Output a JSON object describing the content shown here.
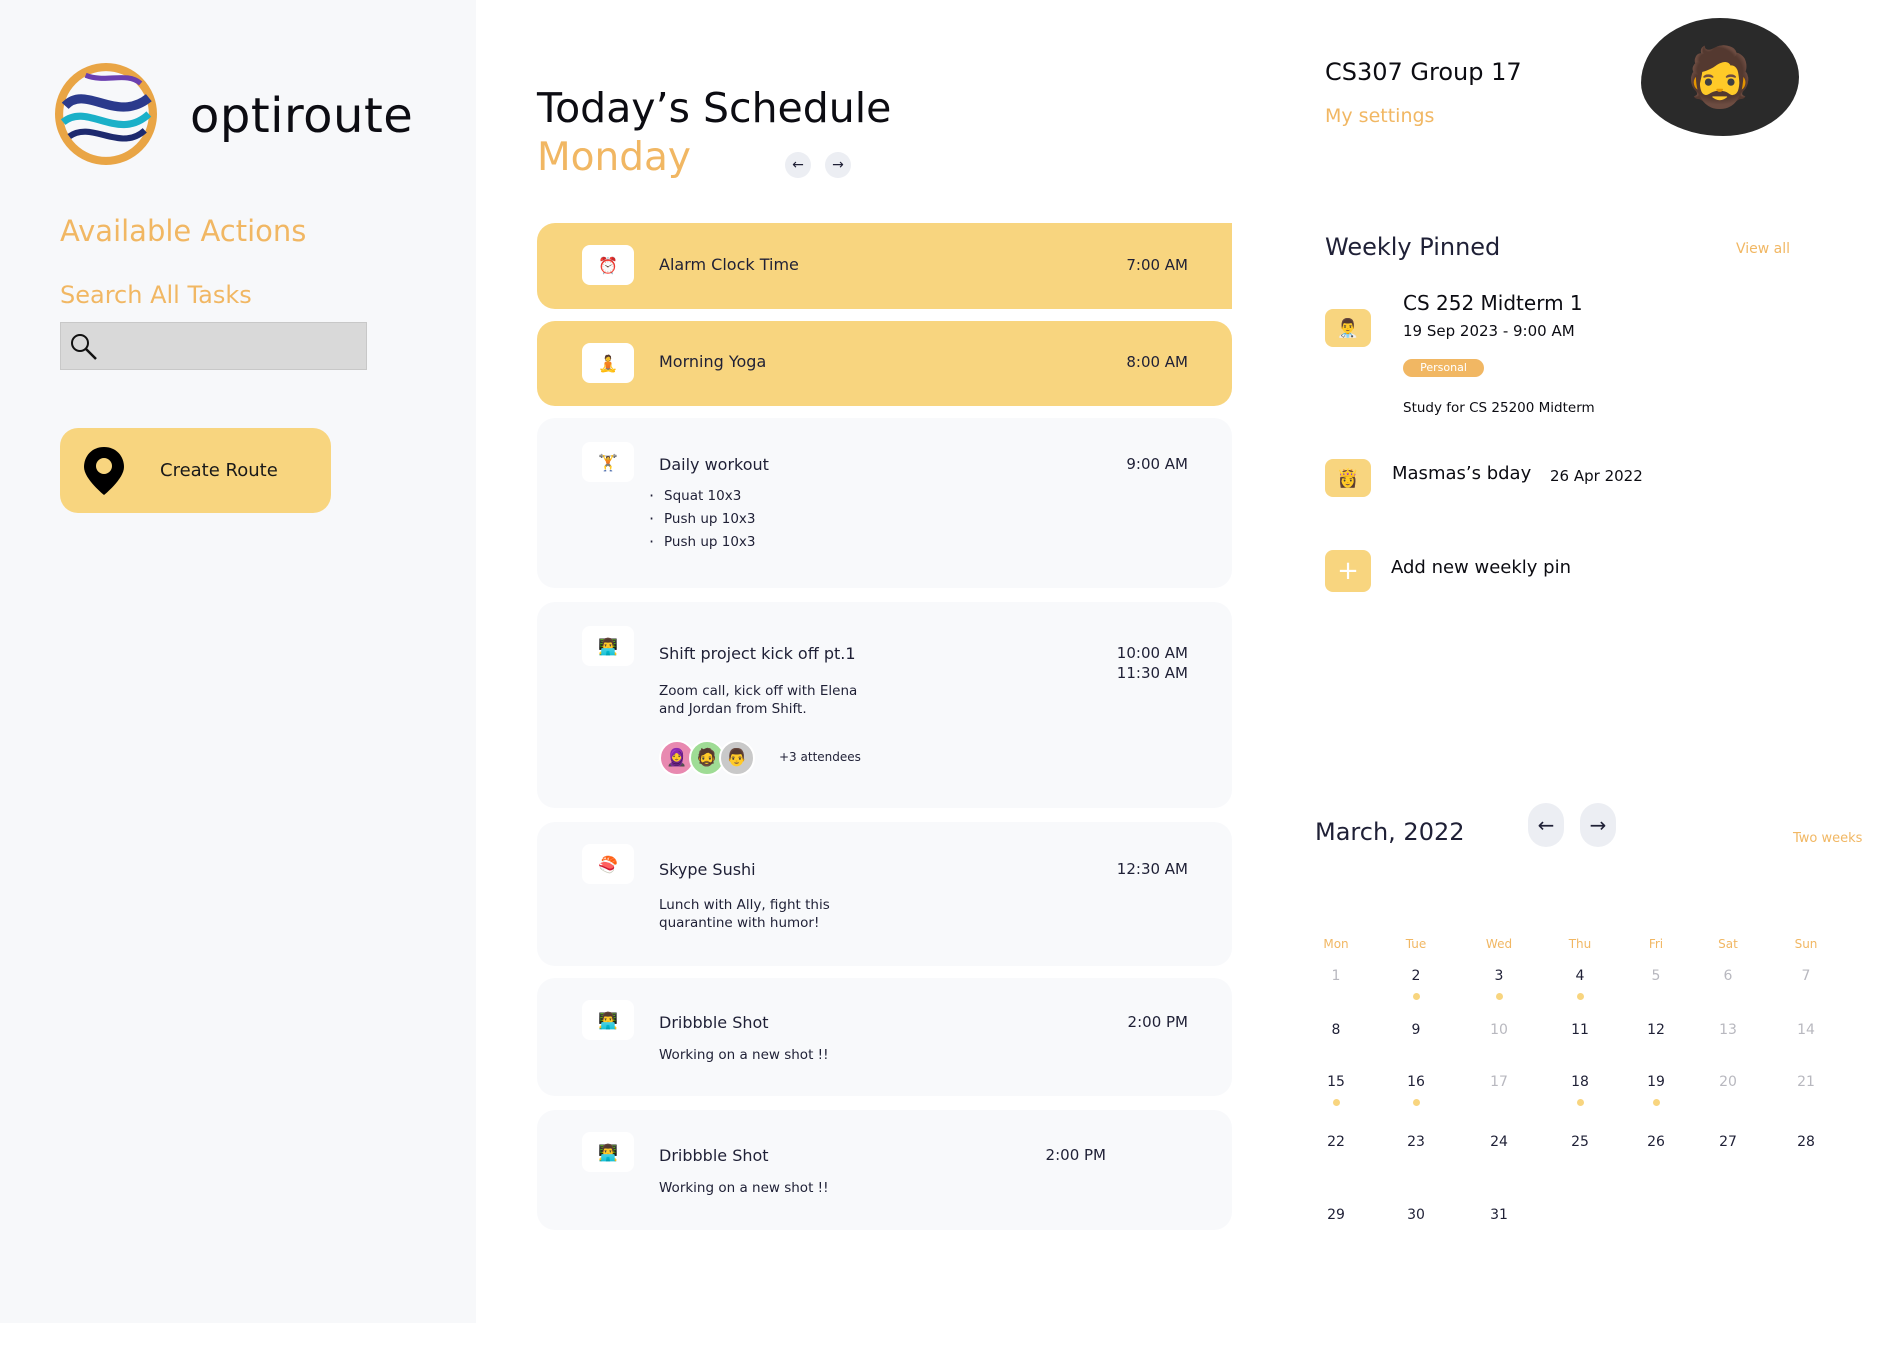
{
  "brand": {
    "name": "optiroute"
  },
  "sidebar": {
    "section_title": "Available Actions",
    "search_label": "Search All Tasks",
    "search_placeholder": "",
    "create_route_label": "Create Route"
  },
  "schedule": {
    "title": "Today’s Schedule",
    "day": "Monday",
    "items": [
      {
        "icon": "alarm-clock",
        "title": "Alarm Clock Time",
        "time": "7:00 AM"
      },
      {
        "icon": "yoga",
        "title": "Morning Yoga",
        "time": "8:00 AM"
      },
      {
        "icon": "weightlifter",
        "title": "Daily workout",
        "time": "9:00 AM",
        "bullets": [
          "Squat 10x3",
          "Push up 10x3",
          "Push up 10x3"
        ]
      },
      {
        "icon": "technologist",
        "title": "Shift project kick off pt.1",
        "time": "10:00 AM",
        "time2": "11:30 AM",
        "description": "Zoom call, kick off with Elena and Jordan from Shift.",
        "attendees": "+3 attendees"
      },
      {
        "icon": "sushi",
        "title": "Skype Sushi",
        "time": "12:30 AM",
        "description": "Lunch with Ally, fight this quarantine with humor!"
      },
      {
        "icon": "technologist",
        "title": "Dribbble Shot",
        "time": "2:00 PM",
        "description": "Working on a new shot !!"
      },
      {
        "icon": "technologist",
        "title": "Dribbble Shot",
        "time": "2:00 PM",
        "description": "Working on a new shot !!"
      }
    ]
  },
  "profile": {
    "group_name": "CS307 Group 17",
    "settings_label": "My settings"
  },
  "weekly_pinned": {
    "title": "Weekly Pinned",
    "view_all": "View all",
    "pins": [
      {
        "icon": "doctor",
        "title": "CS 252 Midterm 1",
        "date": "19 Sep 2023 - 9:00 AM",
        "tag": "Personal",
        "description": "Study for CS 25200 Midterm"
      },
      {
        "icon": "princess",
        "title": "Masmas’s bday",
        "date": "26 Apr 2022"
      }
    ],
    "add_label": "Add new weekly pin"
  },
  "calendar": {
    "month": "March, 2022",
    "view_toggle": "Two weeks",
    "weekdays": [
      "Mon",
      "Tue",
      "Wed",
      "Thu",
      "Fri",
      "Sat",
      "Sun"
    ],
    "accent_color": "#f8d57f",
    "days": [
      {
        "label": "1",
        "muted": true,
        "dot": false
      },
      {
        "label": "2",
        "muted": false,
        "dot": true
      },
      {
        "label": "3",
        "muted": false,
        "dot": true
      },
      {
        "label": "4",
        "muted": false,
        "dot": true
      },
      {
        "label": "5",
        "muted": true,
        "dot": false
      },
      {
        "label": "6",
        "muted": true,
        "dot": false
      },
      {
        "label": "7",
        "muted": true,
        "dot": false
      },
      {
        "label": "8",
        "muted": false,
        "dot": false
      },
      {
        "label": "9",
        "muted": false,
        "dot": false
      },
      {
        "label": "10",
        "muted": true,
        "dot": false
      },
      {
        "label": "11",
        "muted": false,
        "dot": false
      },
      {
        "label": "12",
        "muted": false,
        "dot": false
      },
      {
        "label": "13",
        "muted": true,
        "dot": false
      },
      {
        "label": "14",
        "muted": true,
        "dot": false
      },
      {
        "label": "15",
        "muted": false,
        "dot": true
      },
      {
        "label": "16",
        "muted": false,
        "dot": true
      },
      {
        "label": "17",
        "muted": true,
        "dot": false
      },
      {
        "label": "18",
        "muted": false,
        "dot": true
      },
      {
        "label": "19",
        "muted": false,
        "dot": true
      },
      {
        "label": "20",
        "muted": true,
        "dot": false
      },
      {
        "label": "21",
        "muted": true,
        "dot": false
      },
      {
        "label": "22",
        "muted": false,
        "dot": false
      },
      {
        "label": "23",
        "muted": false,
        "dot": false
      },
      {
        "label": "24",
        "muted": false,
        "dot": false
      },
      {
        "label": "25",
        "muted": false,
        "dot": false
      },
      {
        "label": "26",
        "muted": false,
        "dot": false
      },
      {
        "label": "27",
        "muted": false,
        "dot": false
      },
      {
        "label": "28",
        "muted": false,
        "dot": false
      },
      {
        "label": "29",
        "muted": false,
        "dot": false
      },
      {
        "label": "30",
        "muted": false,
        "dot": false
      },
      {
        "label": "31",
        "muted": false,
        "dot": false
      }
    ]
  },
  "colors": {
    "accent": "#f1b763",
    "highlight": "#f8d57f",
    "text": "#1f2036"
  }
}
